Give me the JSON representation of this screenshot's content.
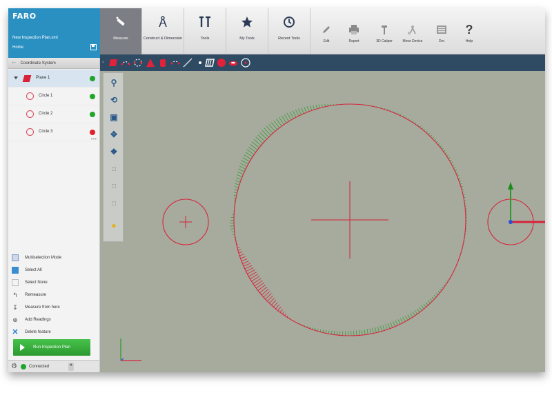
{
  "app": {
    "logo": "FARO",
    "plan_name": "New Inspection Plan.xml",
    "home_label": "Home"
  },
  "ribbon": {
    "tabs": [
      {
        "label": "Measure",
        "icon": "measure-probe-icon",
        "active": true
      },
      {
        "label": "Construct & Dimension",
        "icon": "compass-icon",
        "active": false
      },
      {
        "label": "Tools",
        "icon": "tools-icon",
        "active": false
      },
      {
        "label": "My Tools",
        "icon": "star-icon",
        "active": false
      },
      {
        "label": "Recent Tools",
        "icon": "clock-icon",
        "active": false
      }
    ],
    "buttons": [
      {
        "label": "Edit",
        "icon": "pencil-icon"
      },
      {
        "label": "Report",
        "icon": "printer-icon"
      },
      {
        "label": "3D Caliper",
        "icon": "caliper-icon"
      },
      {
        "label": "Move Device",
        "icon": "move-device-icon"
      },
      {
        "label": "Dro",
        "icon": "dro-icon"
      },
      {
        "label": "Help",
        "icon": "help-icon"
      }
    ]
  },
  "feature_toolbar": {
    "icons": [
      "plane-icon",
      "line-points-icon",
      "circle-points-icon",
      "cone-icon",
      "cylinder-icon",
      "slot-icon",
      "line-icon",
      "point-icon",
      "slot-plane-icon",
      "sphere-icon",
      "ellipse-icon",
      "circle-target-icon"
    ]
  },
  "left_panel": {
    "coord_system_label": "Coordinate System",
    "tree": [
      {
        "label": "Plane 1",
        "type": "plane",
        "status": "#1fa62a",
        "selected": true
      },
      {
        "label": "Circle 1",
        "type": "circle",
        "status": "#1fa62a",
        "selected": false
      },
      {
        "label": "Circle 2",
        "type": "circle",
        "status": "#1fa62a",
        "selected": false
      },
      {
        "label": "Circle 3",
        "type": "circle",
        "status": "#e0202a",
        "selected": false
      }
    ],
    "actions": [
      {
        "label": "Multiselection Mode",
        "icon": "multiselection-icon"
      },
      {
        "label": "Select All",
        "icon": "select-all-icon"
      },
      {
        "label": "Select None",
        "icon": "select-none-icon"
      },
      {
        "label": "Remeasure",
        "icon": "remeasure-icon"
      },
      {
        "label": "Measure from here",
        "icon": "measure-from-here-icon"
      },
      {
        "label": "Add Readings",
        "icon": "add-readings-icon"
      },
      {
        "label": "Delete feature",
        "icon": "delete-icon"
      }
    ],
    "run_button_label": "Run Inspection Plan",
    "status_label": "Connected"
  },
  "vertical_tools": [
    "zoom-icon",
    "rotate-icon",
    "camera-icon",
    "pan-icon",
    "view-cube-icon",
    "front-view-icon",
    "side-view-icon",
    "top-view-icon",
    "light-bulb-icon"
  ],
  "colors": {
    "brand_blue": "#2a90c2",
    "toolbar_navy": "#2f4a63",
    "viewport_bg": "#a6ab9d",
    "feature_red": "#d8223a",
    "status_ok": "#1fa62a",
    "status_bad": "#e0202a",
    "deviation_green": "#3a9a3a"
  }
}
